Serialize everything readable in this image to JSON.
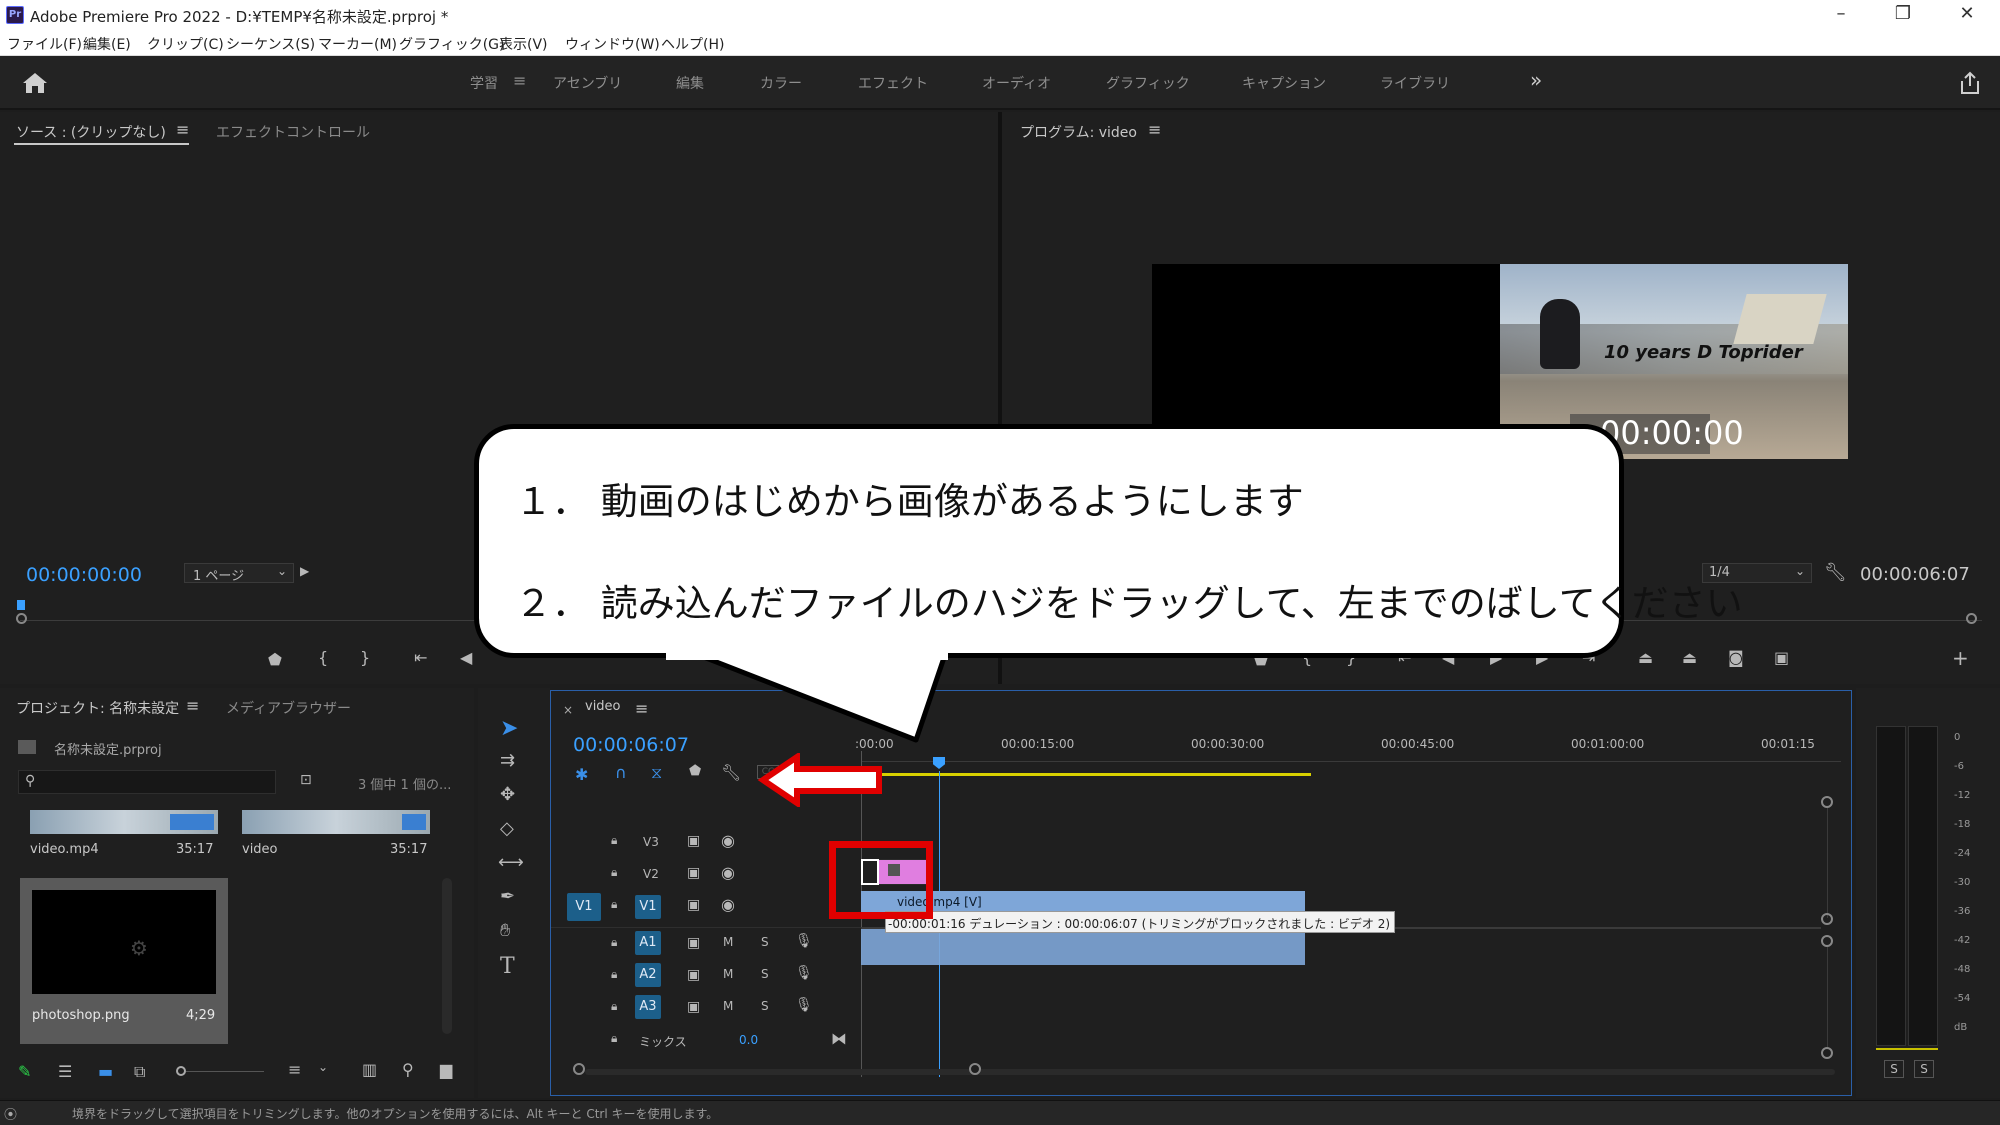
{
  "window": {
    "title": "Adobe Premiere Pro 2022 - D:¥TEMP¥名称未設定.prproj *",
    "app_icon": "Pr",
    "minimize": "–",
    "restore": "❐",
    "close": "✕"
  },
  "menu": [
    "ファイル(F)",
    "編集(E)",
    "クリップ(C)",
    "シーケンス(S)",
    "マーカー(M)",
    "グラフィック(G)",
    "表示(V)",
    "ウィンドウ(W)",
    "ヘルプ(H)"
  ],
  "workspaces": {
    "active": "学習",
    "items": [
      "アセンブリ",
      "編集",
      "カラー",
      "エフェクト",
      "オーディオ",
      "グラフィック",
      "キャプション",
      "ライブラリ"
    ],
    "more": "»"
  },
  "source_panel": {
    "tab_source": "ソース : (クリップなし)",
    "tab_effect": "エフェクトコントロール",
    "timecode": "00:00:00:00",
    "page_select": "1 ページ"
  },
  "program_panel": {
    "tab": "プログラム: video",
    "overlay_timecode": "00:00:00",
    "zoom_select": "1/4",
    "duration": "00:00:06:07",
    "image_text": "10 years D Toprider"
  },
  "project_panel": {
    "tab_project": "プロジェクト: 名称未設定",
    "tab_media": "メディアブラウザー",
    "file": "名称未設定.prproj",
    "count": "3 個中 1 個の...",
    "items": [
      {
        "name": "video.mp4",
        "duration": "35:17"
      },
      {
        "name": "video",
        "duration": "35:17"
      },
      {
        "name": "photoshop.png",
        "duration": "4;29"
      }
    ]
  },
  "timeline": {
    "tab": "video",
    "timecode": "00:00:06:07",
    "ruler": ":00:00",
    "ruler_labels": [
      "00:00:15:00",
      "00:00:30:00",
      "00:00:45:00",
      "00:01:00:00",
      "00:01:15"
    ],
    "tracks_video": [
      "V3",
      "V2",
      "V1"
    ],
    "tracks_audio": [
      "A1",
      "A2",
      "A3"
    ],
    "source_patch": "V1",
    "mix_label": "ミックス",
    "mix_value": "0.0",
    "clip_label": "video.mp4 [V]",
    "tooltip": "-00:00:01:16 デュレーション : 00:00:06:07 (トリミングがブロックされました : ビデオ 2)",
    "m": "M",
    "s": "S"
  },
  "meters": {
    "labels": [
      "0",
      "-6",
      "-12",
      "-18",
      "-24",
      "-30",
      "-36",
      "-42",
      "-48",
      "-54",
      "dB"
    ],
    "solo_left": "S",
    "solo_right": "S"
  },
  "callout": {
    "line1": "１． 動画のはじめから画像があるようにします",
    "line2": "２． 読み込んだファイルのハジをドラッグして、左までのばしてください"
  },
  "status": {
    "text": "境界をドラッグして選択項目をトリミングします。他のオプションを使用するには、Alt キーと Ctrl キーを使用します。"
  },
  "colors": {
    "accent": "#3aa0ff",
    "highlight_red": "#e00000",
    "clip_blue": "#7ea6d8",
    "graphic_pink": "#e07ee0",
    "work_area": "#d8d000"
  }
}
